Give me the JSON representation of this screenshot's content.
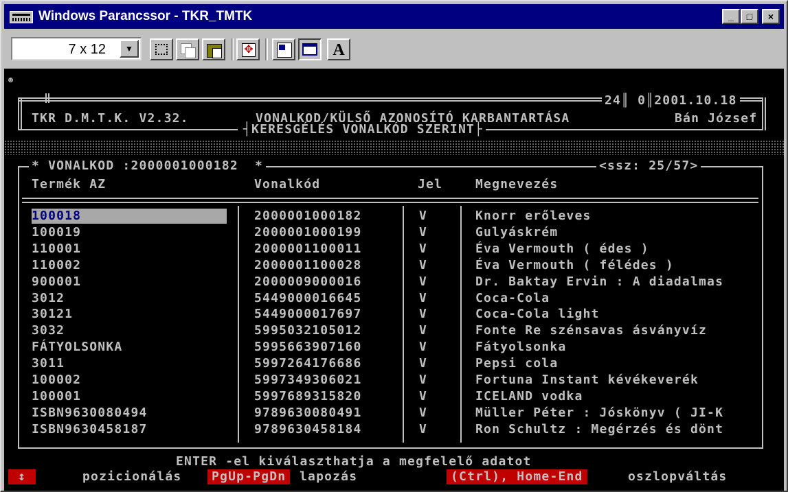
{
  "window": {
    "title": "Windows Parancssor - TKR_TMTK"
  },
  "toolbar": {
    "font_size": "7 x 12"
  },
  "header": {
    "app": "TKR D.M.T.K. V2.32.",
    "module": "VONALKOD/KÜLSŐ AZONOSÍTÓ KARBANTARTÁSA",
    "num1": "24",
    "num2": "0",
    "date": "2001.10.18",
    "user": "Bán József",
    "subtitle": "KERESGÉLÉS VONALKÓD SZERINT"
  },
  "search": {
    "label": "* VONALKOD :2000001000182  *",
    "position": "<ssz: 25/57>"
  },
  "table": {
    "columns": [
      "Termék AZ",
      "Vonalkód",
      "Jel",
      "Megnevezés"
    ],
    "rows": [
      [
        "100018",
        "2000001000182",
        "V",
        "Knorr erőleves"
      ],
      [
        "100019",
        "2000001000199",
        "V",
        "Gulyáskrém"
      ],
      [
        "110001",
        "2000001100011",
        "V",
        "Éva Vermouth ( édes )"
      ],
      [
        "110002",
        "2000001100028",
        "V",
        "Éva Vermouth ( félédes )"
      ],
      [
        "900001",
        "2000009000016",
        "V",
        "Dr. Baktay Ervin : A diadalmas"
      ],
      [
        "3012",
        "5449000016645",
        "V",
        "Coca-Cola"
      ],
      [
        "30121",
        "5449000017697",
        "V",
        "Coca-Cola light"
      ],
      [
        "3032",
        "5995032105012",
        "V",
        "Fonte Re szénsavas ásványvíz"
      ],
      [
        "FÁTYOLSONKA",
        "5995663907160",
        "V",
        "Fátyolsonka"
      ],
      [
        "3011",
        "5997264176686",
        "V",
        "Pepsi cola"
      ],
      [
        "100002",
        "5997349306021",
        "V",
        "Fortuna Instant kévékeverék"
      ],
      [
        "100001",
        "5997689315820",
        "V",
        "ICELAND vodka"
      ],
      [
        "ISBN9630080494",
        "9789630080491",
        "V",
        "Müller Péter : Jóskönyv ( JI-K"
      ],
      [
        "ISBN9630458187",
        "9789630458184",
        "V",
        "Ron Schultz : Megérzés és dönt"
      ]
    ],
    "selected_index": 0
  },
  "footer": {
    "hint": "ENTER -el kiválaszthatja a megfelelő adatot",
    "k1": "↕",
    "t1": "pozicionálás",
    "k2": "PgUp-PgDn",
    "t2": "lapozás",
    "k3": "(Ctrl), Home-End",
    "t3": "oszlopváltás"
  },
  "colors": {
    "title_bar": "#000080",
    "console_bg": "#000000",
    "console_fg": "#c0c0c0",
    "key_bg": "#c00000",
    "selection_bg": "#a8a8a8",
    "selection_fg": "#000080"
  }
}
